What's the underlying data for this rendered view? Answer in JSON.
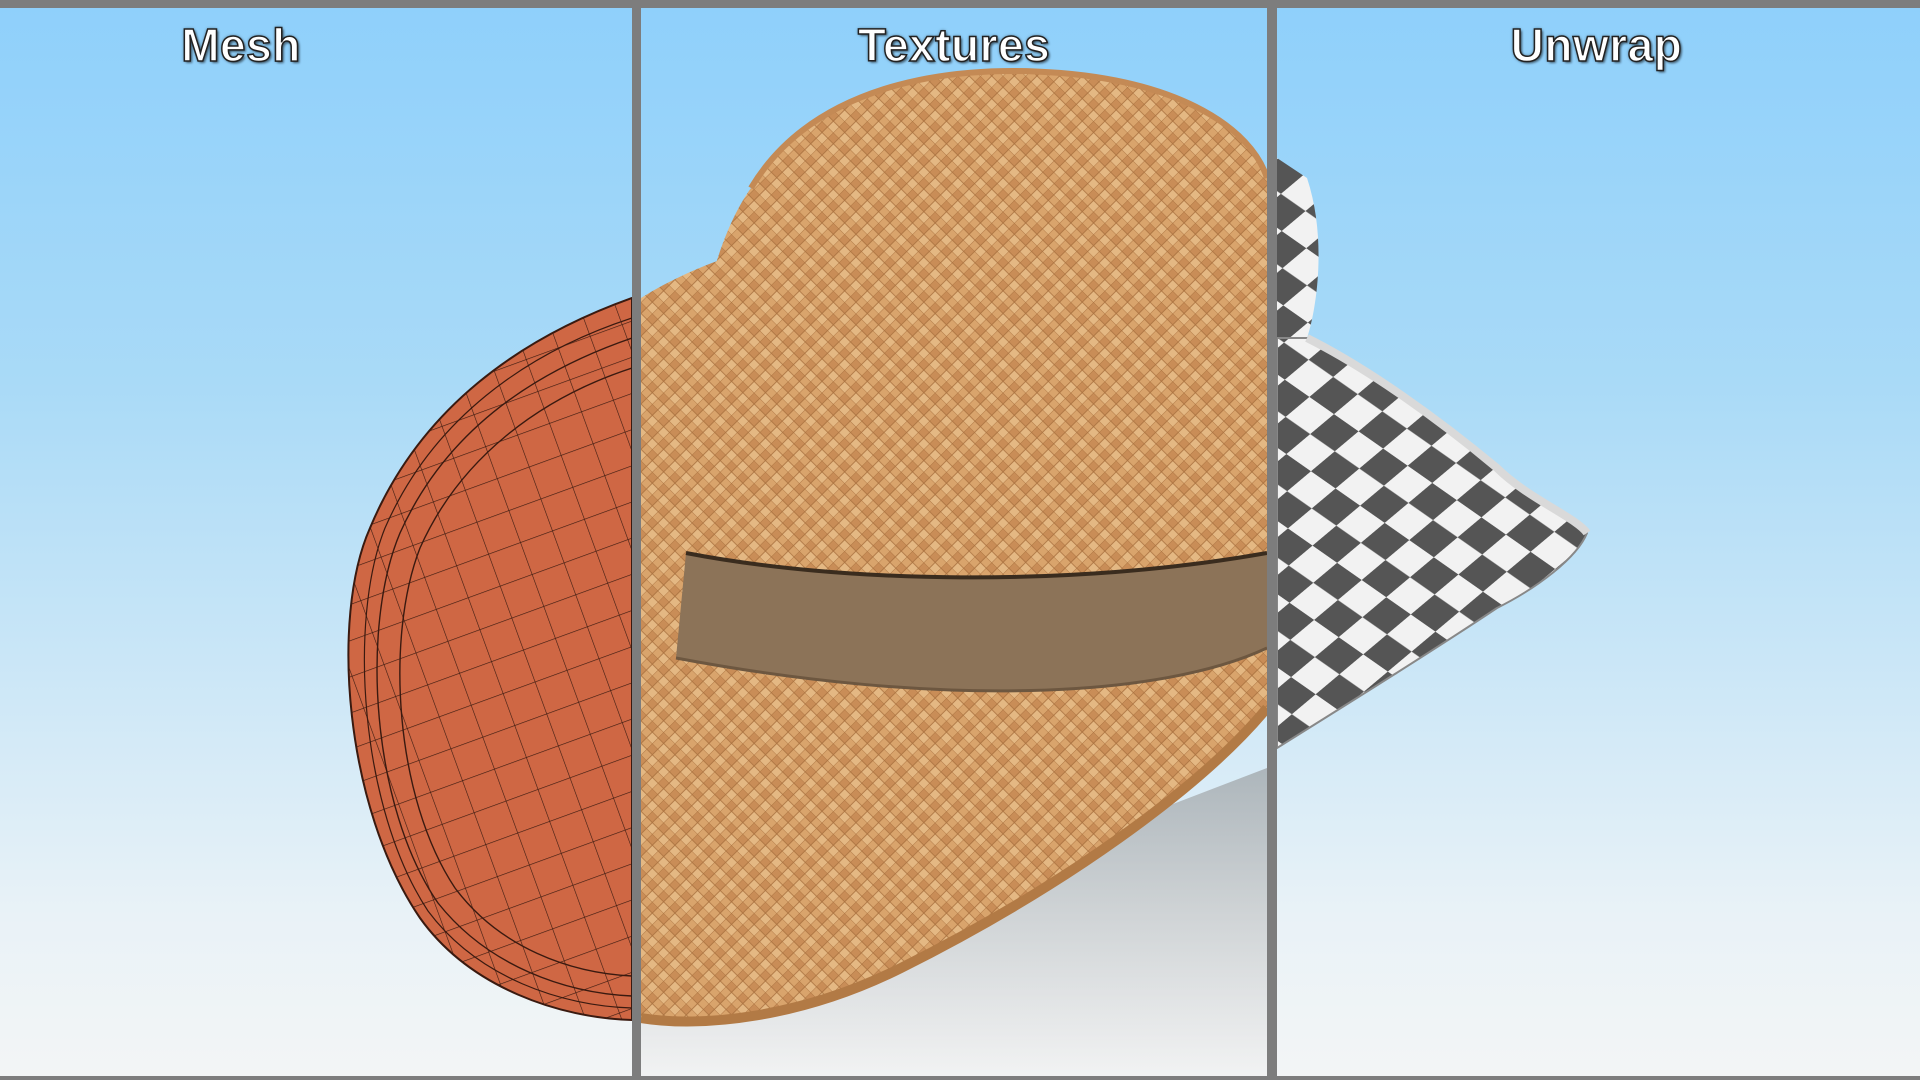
{
  "panels": [
    {
      "title": "Mesh",
      "view": "wireframe-mesh"
    },
    {
      "title": "Textures",
      "view": "textured-straw"
    },
    {
      "title": "Unwrap",
      "view": "uv-checker"
    }
  ],
  "colors": {
    "divider": "#7d7d7d",
    "sky_top": "#8fd0fb",
    "sky_bottom": "#f3f5f6",
    "mesh_fill": "#cf6744",
    "straw": "#d8a26b",
    "band": "#8c7358",
    "checker_dark": "#555555",
    "checker_light": "#f2f2f2"
  }
}
